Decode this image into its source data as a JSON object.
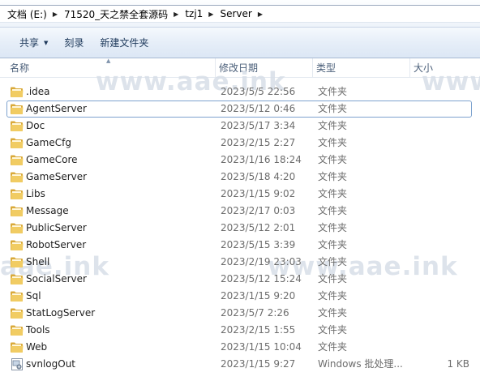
{
  "breadcrumb": [
    {
      "label": "文档 (E:)"
    },
    {
      "label": "71520_天之禁全套源码"
    },
    {
      "label": "tzj1"
    },
    {
      "label": "Server"
    }
  ],
  "toolbar": {
    "share_label": "共享",
    "burn_label": "刻录",
    "new_folder_label": "新建文件夹"
  },
  "columns": {
    "name": "名称",
    "date": "修改日期",
    "type": "类型",
    "size": "大小"
  },
  "files": [
    {
      "name": ".idea",
      "date": "2023/5/5 22:56",
      "type": "文件夹",
      "size": "",
      "icon": "folder-icon"
    },
    {
      "name": "AgentServer",
      "date": "2023/5/12 0:46",
      "type": "文件夹",
      "size": "",
      "icon": "folder-icon",
      "focused": true
    },
    {
      "name": "Doc",
      "date": "2023/5/17 3:34",
      "type": "文件夹",
      "size": "",
      "icon": "folder-icon"
    },
    {
      "name": "GameCfg",
      "date": "2023/2/15 2:27",
      "type": "文件夹",
      "size": "",
      "icon": "folder-icon"
    },
    {
      "name": "GameCore",
      "date": "2023/1/16 18:24",
      "type": "文件夹",
      "size": "",
      "icon": "folder-icon"
    },
    {
      "name": "GameServer",
      "date": "2023/5/18 4:20",
      "type": "文件夹",
      "size": "",
      "icon": "folder-icon"
    },
    {
      "name": "Libs",
      "date": "2023/1/15 9:02",
      "type": "文件夹",
      "size": "",
      "icon": "folder-icon"
    },
    {
      "name": "Message",
      "date": "2023/2/17 0:03",
      "type": "文件夹",
      "size": "",
      "icon": "folder-icon"
    },
    {
      "name": "PublicServer",
      "date": "2023/5/12 2:01",
      "type": "文件夹",
      "size": "",
      "icon": "folder-icon"
    },
    {
      "name": "RobotServer",
      "date": "2023/5/15 3:39",
      "type": "文件夹",
      "size": "",
      "icon": "folder-icon"
    },
    {
      "name": "Shell",
      "date": "2023/2/19 23:03",
      "type": "文件夹",
      "size": "",
      "icon": "folder-icon"
    },
    {
      "name": "SocialServer",
      "date": "2023/5/12 15:24",
      "type": "文件夹",
      "size": "",
      "icon": "folder-icon"
    },
    {
      "name": "Sql",
      "date": "2023/1/15 9:20",
      "type": "文件夹",
      "size": "",
      "icon": "folder-icon"
    },
    {
      "name": "StatLogServer",
      "date": "2023/5/7 2:26",
      "type": "文件夹",
      "size": "",
      "icon": "folder-icon"
    },
    {
      "name": "Tools",
      "date": "2023/2/15 1:55",
      "type": "文件夹",
      "size": "",
      "icon": "folder-icon"
    },
    {
      "name": "Web",
      "date": "2023/1/15 10:04",
      "type": "文件夹",
      "size": "",
      "icon": "folder-icon"
    },
    {
      "name": "svnlogOut",
      "date": "2023/1/15 9:27",
      "type": "Windows 批处理...",
      "size": "1 KB",
      "icon": "batch-file-icon"
    }
  ],
  "watermarks": [
    "www.aae.ink",
    "www.aae.ink",
    "aae.ink",
    "www.aae.ink"
  ],
  "colors": {
    "folder": "#e9c04f",
    "focus_border": "#7da2ce",
    "toolbar_text": "#1e395b"
  }
}
